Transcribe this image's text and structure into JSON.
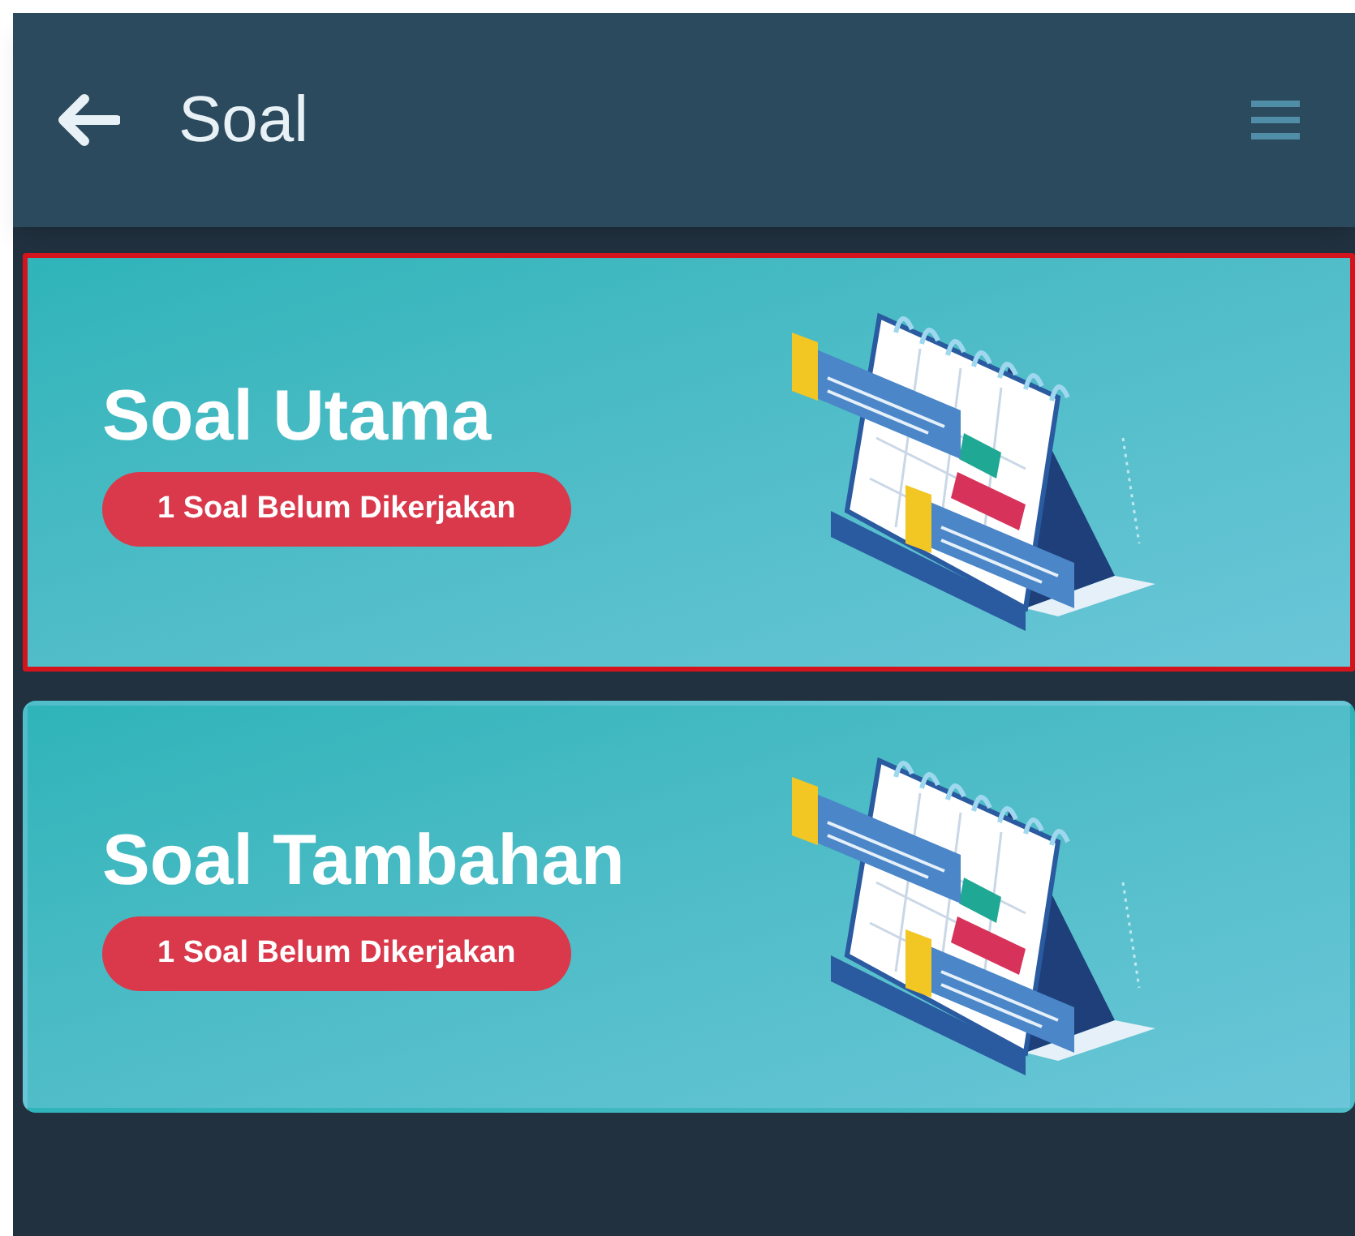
{
  "header": {
    "title": "Soal"
  },
  "cards": [
    {
      "title": "Soal Utama",
      "badge": "1 Soal Belum Dikerjakan",
      "selected": true
    },
    {
      "title": "Soal Tambahan",
      "badge": "1 Soal Belum Dikerjakan",
      "selected": false
    }
  ]
}
